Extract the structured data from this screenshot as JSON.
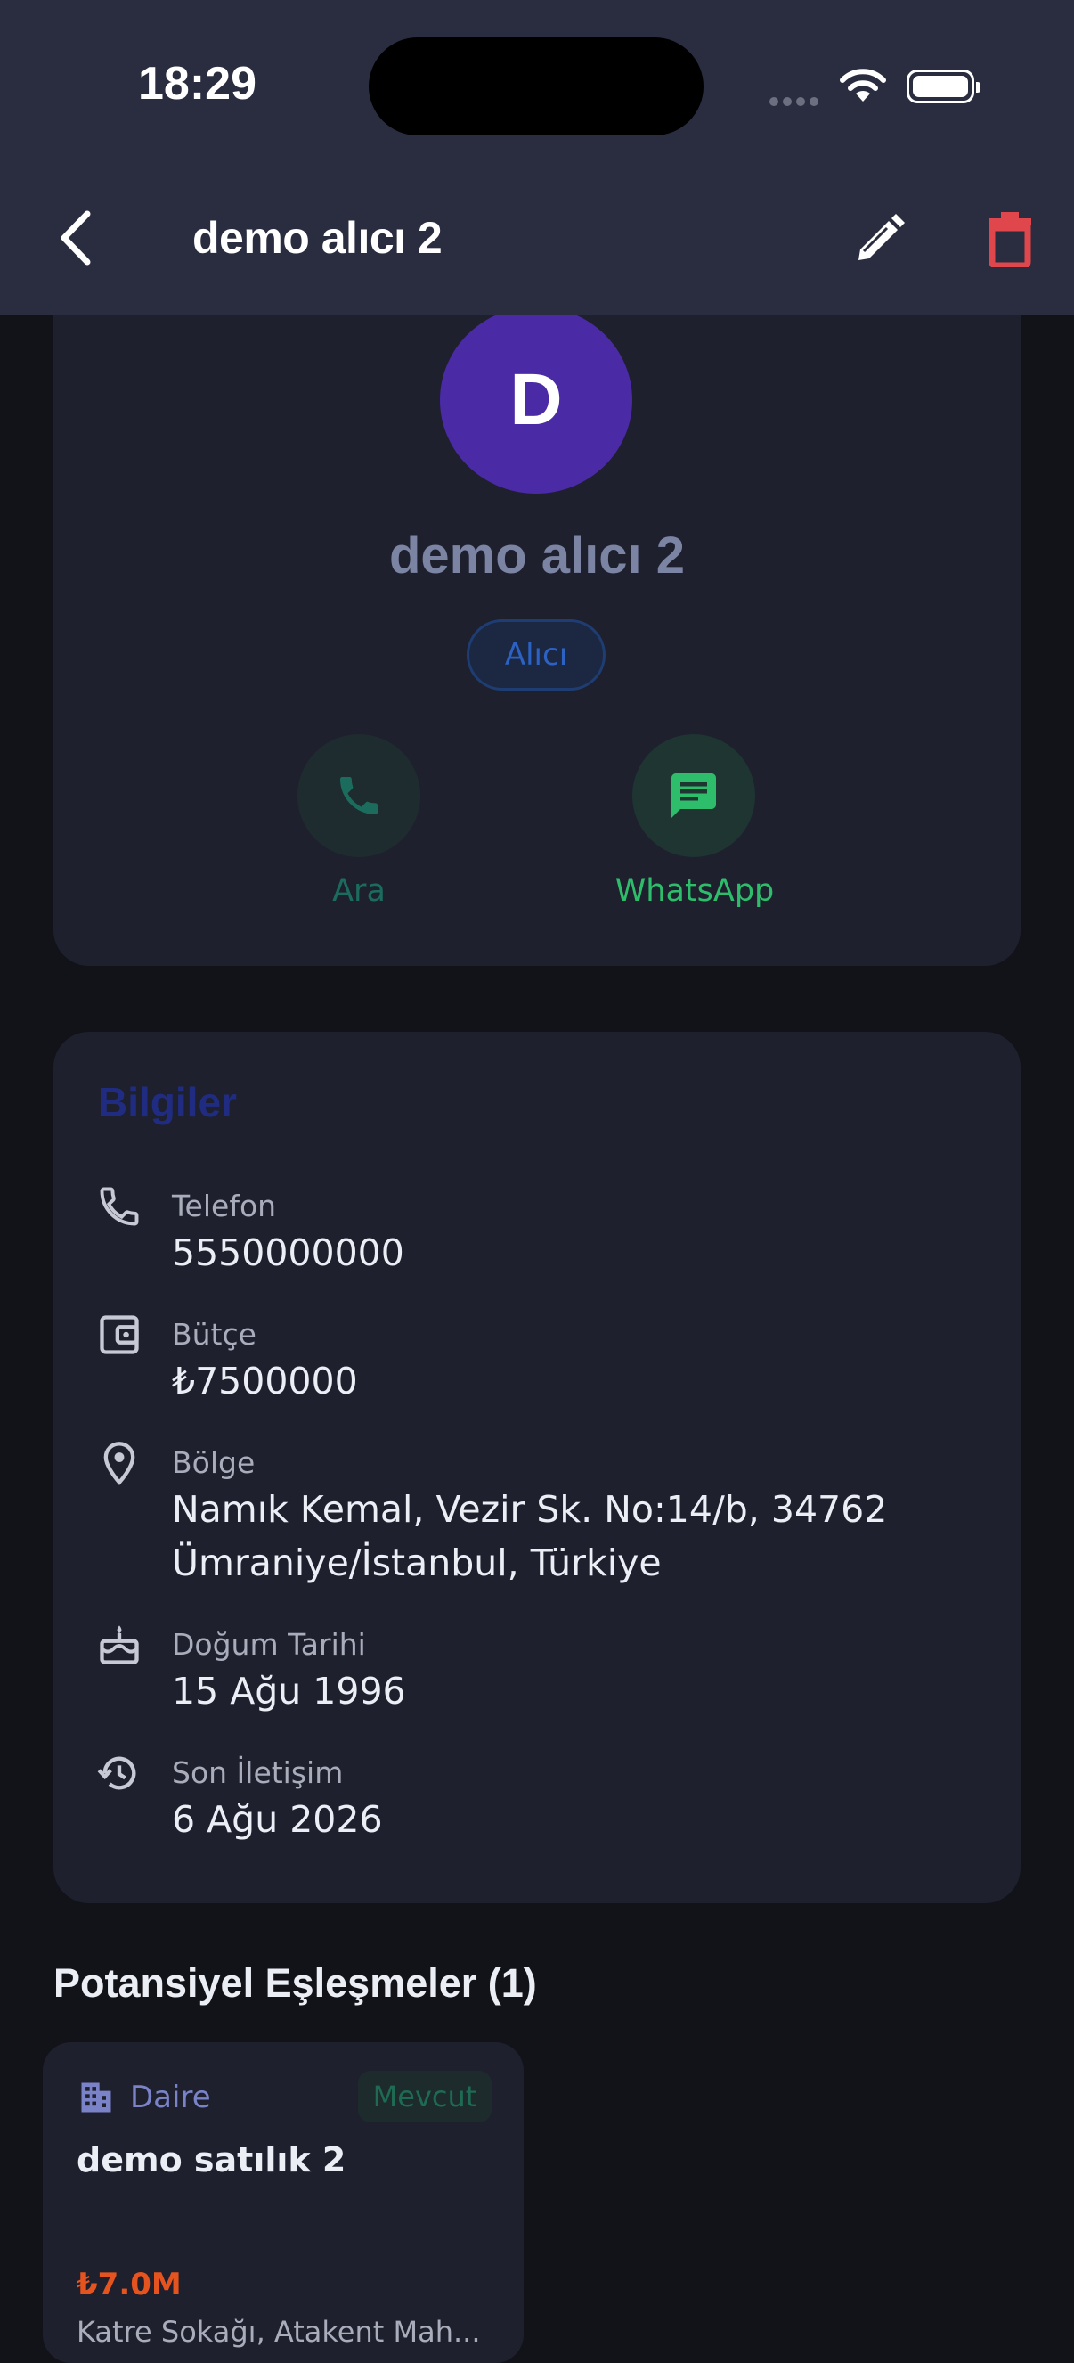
{
  "status_bar": {
    "time": "18:29"
  },
  "header": {
    "title": "demo alıcı 2"
  },
  "profile": {
    "initial": "D",
    "name": "demo alıcı 2",
    "role": "Alıcı",
    "actions": {
      "call": "Ara",
      "whatsapp": "WhatsApp"
    }
  },
  "info": {
    "title": "Bilgiler",
    "items": [
      {
        "label": "Telefon",
        "value": "5550000000",
        "icon": "phone-icon"
      },
      {
        "label": "Bütçe",
        "value": "₺7500000",
        "icon": "wallet-icon"
      },
      {
        "label": "Bölge",
        "value": "Namık Kemal, Vezir Sk. No:14/b, 34762 Ümraniye/İstanbul, Türkiye",
        "icon": "location-pin-icon"
      },
      {
        "label": "Doğum Tarihi",
        "value": "15 Ağu 1996",
        "icon": "cake-icon"
      },
      {
        "label": "Son İletişim",
        "value": "6 Ağu 2026",
        "icon": "history-icon"
      }
    ]
  },
  "matches": {
    "title": "Potansiyel Eşleşmeler (1)",
    "items": [
      {
        "type": "Daire",
        "status": "Mevcut",
        "title": "demo satılık 2",
        "price": "₺7.0M",
        "address": "Katre Sokağı, Atakent Mah..."
      }
    ]
  },
  "colors": {
    "header_bg": "#2a2d40",
    "page_bg": "#121319",
    "card_bg": "#1e202e",
    "avatar_bg": "#4a2aa5",
    "delete_red": "#e0474c",
    "whatsapp_green": "#2ebd6a",
    "price_orange": "#e5531f"
  }
}
